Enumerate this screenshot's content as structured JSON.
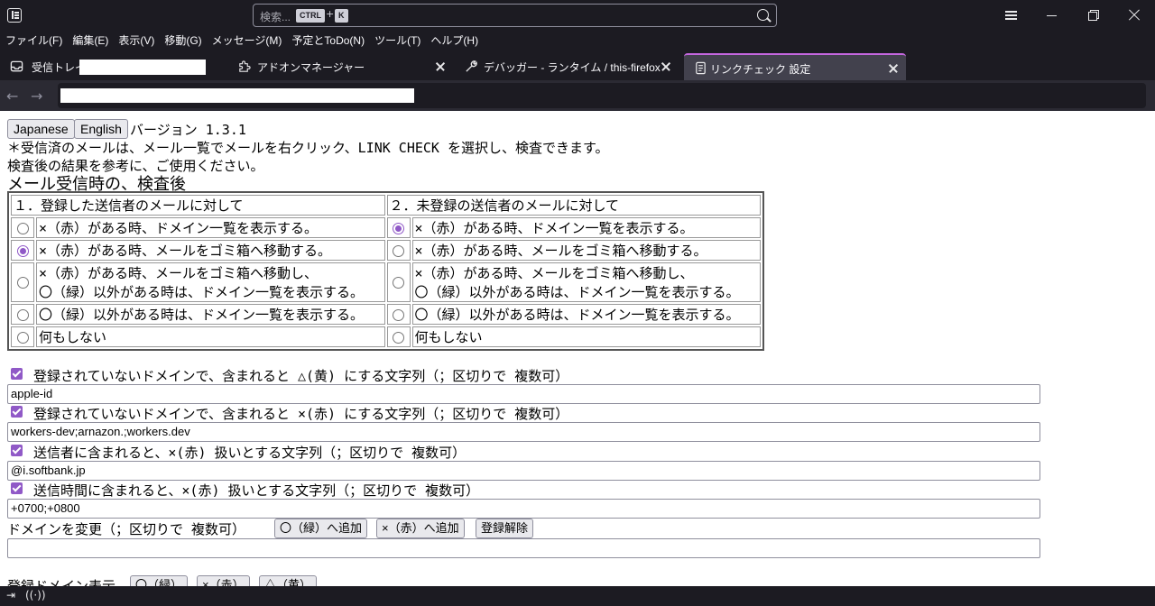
{
  "titlebar": {
    "search_placeholder": "検索...",
    "shortcut_key1": "CTRL",
    "shortcut_plus": "+",
    "shortcut_key2": "K"
  },
  "menu": [
    "ファイル(F)",
    "編集(E)",
    "表示(V)",
    "移動(G)",
    "メッセージ(M)",
    "予定とToDo(N)",
    "ツール(T)",
    "ヘルプ(H)"
  ],
  "tabs": [
    {
      "label": "受信トレイ"
    },
    {
      "label": "アドオンマネージャー"
    },
    {
      "label": "デバッガー - ランタイム / this-firefox"
    },
    {
      "label": "リンクチェック 設定"
    }
  ],
  "page": {
    "btn_japanese": "Japanese",
    "btn_english": "English",
    "version": "バージョン 1.3.1",
    "intro1": "＊受信済のメールは、メール一覧でメールを右クリック、LINK CHECK を選択し、検査できます。",
    "intro2": "検査後の結果を参考に、ご使用ください。",
    "section_title": "メール受信時の、検査後",
    "col1_header": "１．登録した送信者のメールに対して",
    "col2_header": "２．未登録の送信者のメールに対して",
    "options": [
      {
        "text": "×（赤）がある時、ドメイン一覧を表示する。",
        "left_selected": false,
        "right_selected": true
      },
      {
        "text": "×（赤）がある時、メールをゴミ箱へ移動する。",
        "left_selected": true,
        "right_selected": false
      },
      {
        "text": "×（赤）がある時、メールをゴミ箱へ移動し、",
        "text2": "〇（緑）以外がある時は、ドメイン一覧を表示する。",
        "left_selected": false,
        "right_selected": false
      },
      {
        "text": "〇（緑）以外がある時は、ドメイン一覧を表示する。",
        "left_selected": false,
        "right_selected": false
      },
      {
        "text": "何もしない",
        "left_selected": false,
        "right_selected": false
      }
    ],
    "filters": [
      {
        "label": "登録されていないドメインで、含まれると △(黄) にする文字列（；区切りで 複数可）",
        "value": "apple-id"
      },
      {
        "label": "登録されていないドメインで、含まれると ×(赤) にする文字列（；区切りで 複数可）",
        "value": "workers-dev;arnazon.;workers.dev"
      },
      {
        "label": "送信者に含まれると、×(赤) 扱いとする文字列（；区切りで 複数可）",
        "value": "@i.softbank.jp"
      },
      {
        "label": "送信時間に含まれると、×(赤) 扱いとする文字列（；区切りで 複数可）",
        "value": "+0700;+0800"
      }
    ],
    "domain_change_label": "ドメインを変更（；区切りで 複数可）",
    "btn_add_green": "〇（緑）へ追加",
    "btn_add_red": "×（赤）へ追加",
    "btn_unregister": "登録解除",
    "domain_input_value": "",
    "registered_label": "登録ドメイン表示",
    "btn_show_green": "〇（緑）",
    "btn_show_red": "×（赤）",
    "btn_show_yellow": "△（黄）"
  },
  "colors": {
    "accent": "#9059c7",
    "tab_highlight": "#c567e0",
    "chrome_bg": "#1c1b22"
  }
}
